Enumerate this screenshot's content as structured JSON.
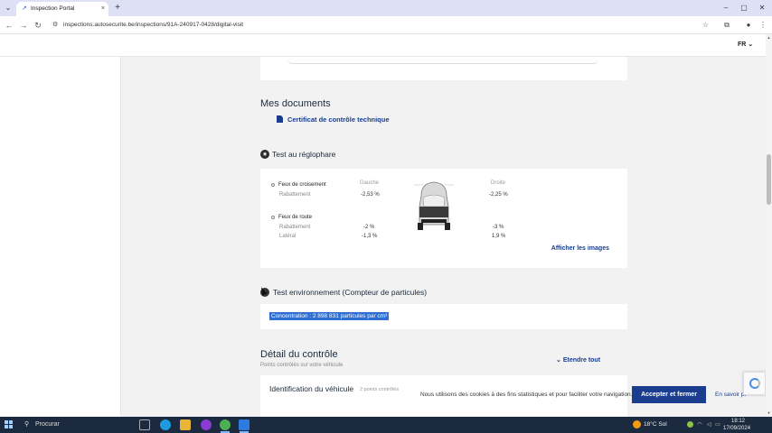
{
  "browser": {
    "tab_title": "Inspection Portal",
    "tab_close": "×",
    "new_tab": "+",
    "url": "inspections.autosecurite.be/inspections/91A-240917-0428/digital-visit",
    "window_controls": {
      "minimize": "–",
      "maximize": "▢",
      "close": "✕"
    }
  },
  "header": {
    "language": "FR"
  },
  "documents": {
    "title": "Mes documents",
    "link": "Certificat de contrôle technique"
  },
  "headlight_test": {
    "title": "Test au réglophare",
    "col_left": "Gauche",
    "col_right": "Droite",
    "low_beam": {
      "label": "Feux de croisement",
      "sub": "Rabattement",
      "left": "-2,53 %",
      "right": "-2,25 %"
    },
    "high_beam": {
      "label": "Feux de route",
      "sub1": "Rabattement",
      "left1": "-2 %",
      "right1": "-3 %",
      "sub2": "Latéral",
      "left2": "-1,3 %",
      "right2": "1,9 %"
    },
    "images_link": "Afficher les images"
  },
  "env_test": {
    "title": "Test environnement (Compteur de particules)",
    "concentration": "Concentration : 2 898 831 particules par cm³"
  },
  "detail": {
    "title": "Détail du contrôle",
    "subtitle": "Points contrôlés sur votre véhicule",
    "expand": "Etendre tout",
    "row1_title": "Identification du véhicule",
    "row1_meta": "2 points contrôlés"
  },
  "cookie": {
    "text": "Nous utilisons des cookies à des fins statistiques et pour faciliter votre navigation.",
    "accept": "Accepter et fermer",
    "more": "En savoir pl"
  },
  "taskbar": {
    "search_placeholder": "Procurar",
    "weather": "18°C  Sol",
    "time": "18:12",
    "date": "17/09/2024"
  },
  "colors": {
    "accent": "#1a3d8f",
    "selection": "#2f6fd1",
    "taskbar": "#1b2a3e"
  }
}
